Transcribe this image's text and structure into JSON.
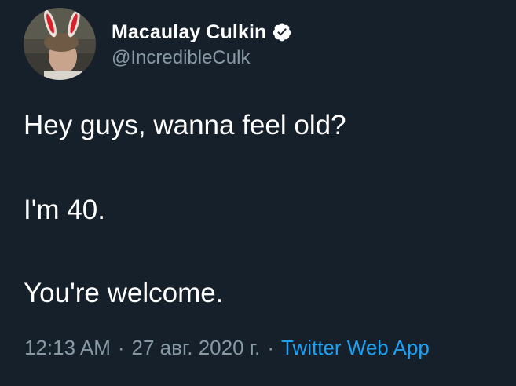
{
  "author": {
    "display_name": "Macaulay Culkin",
    "handle": "@IncredibleCulk",
    "verified": true,
    "avatar_icon": "profile-photo-bunny-ears"
  },
  "tweet": {
    "lines": [
      "Hey guys, wanna feel old?",
      "I'm 40.",
      "You're welcome."
    ]
  },
  "meta": {
    "time": "12:13 AM",
    "separator": "·",
    "date": "27 авг. 2020 г.",
    "source": "Twitter Web App"
  },
  "colors": {
    "background": "#15202b",
    "primary_text": "#ffffff",
    "secondary_text": "#8899a6",
    "link": "#1da1f2"
  }
}
